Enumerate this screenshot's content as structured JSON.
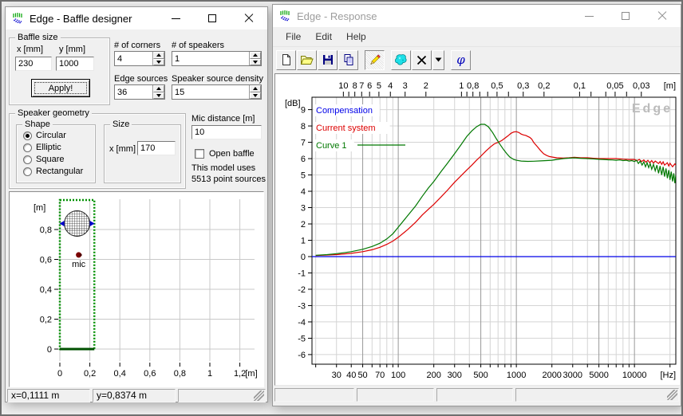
{
  "left_window": {
    "title": "Edge - Baffle designer",
    "baffle_size": {
      "label": "Baffle size",
      "x_label": "x [mm]",
      "x_value": "230",
      "y_label": "y [mm]",
      "y_value": "1000",
      "apply_label": "Apply!"
    },
    "corners": {
      "label": "# of corners",
      "value": "4"
    },
    "speakers": {
      "label": "# of speakers",
      "value": "1"
    },
    "edge_sources": {
      "label": "Edge sources",
      "value": "36"
    },
    "source_density": {
      "label": "Speaker source density",
      "value": "15"
    },
    "speaker_geometry": {
      "label": "Speaker geometry",
      "shape": {
        "label": "Shape",
        "options": [
          "Circular",
          "Elliptic",
          "Square",
          "Rectangular"
        ],
        "selected": "Circular"
      },
      "size": {
        "label": "Size",
        "x_label": "x [mm]",
        "value": "170"
      }
    },
    "mic_distance": {
      "label": "Mic distance [m]",
      "value": "10"
    },
    "open_baffle": {
      "label": "Open baffle",
      "checked": false
    },
    "model_info": [
      "This model uses",
      "5513 point sources"
    ],
    "status": [
      "x=0,1111 m",
      "y=0,8374 m",
      ""
    ]
  },
  "right_window": {
    "title": "Edge - Response",
    "menu": [
      "File",
      "Edit",
      "Help"
    ],
    "toolbar": [
      {
        "name": "new-file"
      },
      {
        "name": "open-file"
      },
      {
        "name": "save-file"
      },
      {
        "name": "copy"
      },
      {
        "name": "pencil-tool",
        "active": true
      },
      {
        "name": "blob-tool"
      },
      {
        "name": "delete-curve"
      },
      {
        "name": "delete-dropdown"
      },
      {
        "name": "phase",
        "glyph": "φ"
      }
    ],
    "status": [
      "",
      "",
      "",
      ""
    ]
  },
  "chart_data": [
    {
      "type": "line",
      "title": "Frequency response",
      "watermark": "Edge",
      "legend": [
        "Compensation",
        "Current system",
        "Curve 1"
      ],
      "legend_position": "top-left",
      "grid": true,
      "x_axis": {
        "label": "[Hz]",
        "scale": "log",
        "min": 18.6,
        "max": 22400,
        "labeled_ticks": [
          [
            30,
            "30"
          ],
          [
            40,
            "40"
          ],
          [
            50,
            "50"
          ],
          [
            70,
            "70"
          ],
          [
            100,
            "100"
          ],
          [
            200,
            "200"
          ],
          [
            300,
            "300"
          ],
          [
            500,
            "500"
          ],
          [
            1000,
            "1000"
          ],
          [
            2000,
            "2000"
          ],
          [
            3000,
            "3000"
          ],
          [
            5000,
            "5000"
          ],
          [
            10000,
            "10000"
          ]
        ],
        "gridlines_minor": [
          20,
          30,
          40,
          60,
          70,
          80,
          90,
          200,
          300,
          400,
          600,
          700,
          800,
          900,
          2000,
          3000,
          4000,
          6000,
          7000,
          8000,
          9000,
          20000
        ],
        "gridlines_major": [
          50,
          100,
          500,
          1000,
          5000,
          10000
        ]
      },
      "top_axis": {
        "label": "[m]",
        "meaning": "wavelength = 343 / frequency",
        "speed_of_sound": 343,
        "labeled_ticks": [
          [
            10,
            "10"
          ],
          [
            8,
            "8"
          ],
          [
            7,
            "7"
          ],
          [
            6,
            "6"
          ],
          [
            5,
            "5"
          ],
          [
            4,
            "4"
          ],
          [
            3,
            "3"
          ],
          [
            2,
            "2"
          ],
          [
            1,
            "1"
          ],
          [
            0.8,
            "0,8"
          ],
          [
            0.5,
            "0,5"
          ],
          [
            0.3,
            "0,3"
          ],
          [
            0.2,
            "0,2"
          ],
          [
            0.1,
            "0,1"
          ],
          [
            0.05,
            "0,05"
          ],
          [
            0.03,
            "0,03"
          ]
        ],
        "minor_ticks": [
          9,
          0.9,
          0.7,
          0.6,
          0.4,
          0.08,
          0.06,
          0.04
        ]
      },
      "y_axis": {
        "label": "[dB]",
        "min": -6.59,
        "max": 9.76,
        "ticks": [
          9,
          8,
          7,
          6,
          5,
          4,
          3,
          2,
          1,
          0,
          -1,
          -2,
          -3,
          -4,
          -5,
          -6
        ]
      },
      "series": [
        {
          "name": "Compensation",
          "color": "#0000e8",
          "points": [
            [
              18.6,
              0
            ],
            [
              22400,
              0
            ]
          ]
        },
        {
          "name": "Current system",
          "color": "#dd0000",
          "points": [
            [
              20,
              0.06
            ],
            [
              30,
              0.12
            ],
            [
              40,
              0.2
            ],
            [
              50,
              0.3
            ],
            [
              60,
              0.42
            ],
            [
              70,
              0.57
            ],
            [
              80,
              0.75
            ],
            [
              90,
              0.95
            ],
            [
              100,
              1.18
            ],
            [
              120,
              1.65
            ],
            [
              140,
              2.1
            ],
            [
              160,
              2.55
            ],
            [
              180,
              2.9
            ],
            [
              200,
              3.2
            ],
            [
              230,
              3.65
            ],
            [
              260,
              4.05
            ],
            [
              300,
              4.55
            ],
            [
              340,
              4.95
            ],
            [
              380,
              5.3
            ],
            [
              420,
              5.6
            ],
            [
              460,
              5.9
            ],
            [
              500,
              6.15
            ],
            [
              550,
              6.45
            ],
            [
              600,
              6.7
            ],
            [
              650,
              6.9
            ],
            [
              700,
              7.0
            ],
            [
              750,
              7.1
            ],
            [
              800,
              7.25
            ],
            [
              850,
              7.4
            ],
            [
              900,
              7.55
            ],
            [
              950,
              7.63
            ],
            [
              1000,
              7.65
            ],
            [
              1050,
              7.6
            ],
            [
              1100,
              7.5
            ],
            [
              1150,
              7.45
            ],
            [
              1200,
              7.42
            ],
            [
              1300,
              7.3
            ],
            [
              1350,
              7.2
            ],
            [
              1400,
              7.0
            ],
            [
              1500,
              6.75
            ],
            [
              1600,
              6.5
            ],
            [
              1700,
              6.3
            ],
            [
              1800,
              6.2
            ],
            [
              1900,
              6.13
            ],
            [
              2000,
              6.1
            ],
            [
              2200,
              6.05
            ],
            [
              2500,
              6.03
            ],
            [
              2800,
              6.05
            ],
            [
              3100,
              6.08
            ],
            [
              3500,
              6.05
            ],
            [
              4000,
              6.05
            ],
            [
              4500,
              6.02
            ],
            [
              5000,
              6.0
            ],
            [
              6000,
              6.0
            ],
            [
              7000,
              6.0
            ],
            [
              8000,
              5.97
            ],
            [
              9000,
              5.95
            ],
            [
              10000,
              5.95
            ],
            [
              10500,
              5.88
            ],
            [
              11000,
              5.95
            ],
            [
              11500,
              5.82
            ],
            [
              12000,
              5.92
            ],
            [
              12500,
              5.78
            ],
            [
              13000,
              5.9
            ],
            [
              13500,
              5.75
            ],
            [
              14000,
              5.88
            ],
            [
              14500,
              5.72
            ],
            [
              15000,
              5.85
            ],
            [
              16000,
              5.7
            ],
            [
              16500,
              5.82
            ],
            [
              17000,
              5.65
            ],
            [
              17500,
              5.8
            ],
            [
              18000,
              5.6
            ],
            [
              19000,
              5.75
            ],
            [
              19500,
              5.55
            ],
            [
              20000,
              5.72
            ],
            [
              21000,
              5.5
            ],
            [
              22000,
              5.68
            ],
            [
              22400,
              5.6
            ]
          ]
        },
        {
          "name": "Curve 1",
          "color": "#007800",
          "points": [
            [
              20,
              0.08
            ],
            [
              25,
              0.12
            ],
            [
              30,
              0.18
            ],
            [
              40,
              0.3
            ],
            [
              50,
              0.45
            ],
            [
              60,
              0.62
            ],
            [
              70,
              0.82
            ],
            [
              80,
              1.08
            ],
            [
              90,
              1.4
            ],
            [
              100,
              1.8
            ],
            [
              120,
              2.5
            ],
            [
              140,
              3.1
            ],
            [
              160,
              3.7
            ],
            [
              180,
              4.2
            ],
            [
              200,
              4.6
            ],
            [
              230,
              5.2
            ],
            [
              260,
              5.7
            ],
            [
              300,
              6.3
            ],
            [
              340,
              6.85
            ],
            [
              380,
              7.35
            ],
            [
              420,
              7.7
            ],
            [
              460,
              7.95
            ],
            [
              500,
              8.1
            ],
            [
              540,
              8.1
            ],
            [
              580,
              7.95
            ],
            [
              630,
              7.6
            ],
            [
              680,
              7.2
            ],
            [
              730,
              6.85
            ],
            [
              780,
              6.55
            ],
            [
              830,
              6.3
            ],
            [
              880,
              6.1
            ],
            [
              950,
              5.95
            ],
            [
              1000,
              5.9
            ],
            [
              1100,
              5.85
            ],
            [
              1250,
              5.83
            ],
            [
              1400,
              5.84
            ],
            [
              1600,
              5.86
            ],
            [
              1800,
              5.88
            ],
            [
              2000,
              5.9
            ],
            [
              2200,
              5.95
            ],
            [
              2500,
              6.0
            ],
            [
              2800,
              6.03
            ],
            [
              3100,
              6.05
            ],
            [
              3500,
              6.02
            ],
            [
              4000,
              6.0
            ],
            [
              4500,
              5.98
            ],
            [
              5000,
              5.96
            ],
            [
              5500,
              5.95
            ],
            [
              6000,
              5.93
            ],
            [
              6500,
              5.92
            ],
            [
              7000,
              5.9
            ],
            [
              7500,
              5.92
            ],
            [
              8000,
              5.88
            ],
            [
              8500,
              5.9
            ],
            [
              9000,
              5.85
            ],
            [
              9500,
              5.88
            ],
            [
              10000,
              5.82
            ],
            [
              10400,
              5.9
            ],
            [
              10800,
              5.7
            ],
            [
              11200,
              5.85
            ],
            [
              11600,
              5.6
            ],
            [
              12000,
              5.8
            ],
            [
              12400,
              5.5
            ],
            [
              12800,
              5.75
            ],
            [
              13200,
              5.45
            ],
            [
              13600,
              5.7
            ],
            [
              14000,
              5.35
            ],
            [
              14500,
              5.65
            ],
            [
              15000,
              5.25
            ],
            [
              15500,
              5.6
            ],
            [
              16000,
              5.1
            ],
            [
              16500,
              5.55
            ],
            [
              17000,
              5.0
            ],
            [
              17500,
              5.5
            ],
            [
              18000,
              4.9
            ],
            [
              18500,
              5.4
            ],
            [
              19000,
              4.8
            ],
            [
              19500,
              5.3
            ],
            [
              20000,
              4.7
            ],
            [
              20500,
              5.2
            ],
            [
              21000,
              4.6
            ],
            [
              21500,
              5.1
            ],
            [
              22000,
              4.5
            ],
            [
              22400,
              5.0
            ]
          ]
        }
      ]
    },
    {
      "type": "baffle-layout",
      "x_axis": {
        "label": "[m]",
        "labeled_ticks": [
          [
            0,
            "0"
          ],
          [
            0.2,
            "0,2"
          ],
          [
            0.4,
            "0,4"
          ],
          [
            0.6,
            "0,6"
          ],
          [
            0.8,
            "0,8"
          ],
          [
            1,
            "1"
          ],
          [
            1.2,
            "1,2"
          ]
        ]
      },
      "y_axis": {
        "label": "[m]",
        "labeled_ticks": [
          [
            0,
            "0"
          ],
          [
            0.2,
            "0,2"
          ],
          [
            0.4,
            "0,4"
          ],
          [
            0.6,
            "0,6"
          ],
          [
            0.8,
            "0,8"
          ]
        ]
      },
      "baffle": {
        "x": 0,
        "y": 0,
        "width": 0.23,
        "height": 1.0,
        "color": "#009000"
      },
      "speaker": {
        "cx": 0.115,
        "cy": 0.84,
        "diameter": 0.17
      },
      "mic": {
        "x": 0.115,
        "y": 0.63,
        "label": "mic",
        "color": "#7b0000"
      }
    }
  ]
}
